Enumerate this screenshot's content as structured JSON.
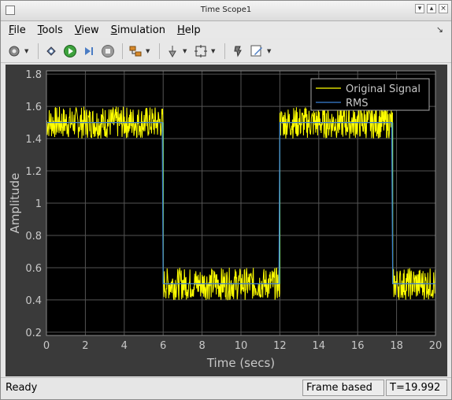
{
  "window": {
    "title": "Time Scope1"
  },
  "menu": {
    "items": [
      {
        "label": "File",
        "accel": "F",
        "rest": "ile"
      },
      {
        "label": "Tools",
        "accel": "T",
        "rest": "ools"
      },
      {
        "label": "View",
        "accel": "V",
        "rest": "iew"
      },
      {
        "label": "Simulation",
        "accel": "S",
        "rest": "imulation"
      },
      {
        "label": "Help",
        "accel": "H",
        "rest": "elp"
      }
    ]
  },
  "status": {
    "ready": "Ready",
    "mode": "Frame based",
    "time": "T=19.992"
  },
  "colors": {
    "plot_bg": "#000000",
    "figure_bg": "#3a3a3a",
    "grid": "#555555",
    "original_signal": "#ffff00",
    "rms": "#3b7fd4",
    "axis_text": "#c8c8c8"
  },
  "chart_data": {
    "type": "line",
    "xlabel": "Time (secs)",
    "ylabel": "Amplitude",
    "xlim": [
      0,
      20
    ],
    "ylim": [
      0.18,
      1.82
    ],
    "xticks": [
      "0",
      "2",
      "4",
      "6",
      "8",
      "10",
      "12",
      "14",
      "16",
      "18",
      "20"
    ],
    "yticks": [
      "0.2",
      "0.4",
      "0.6",
      "0.8",
      "1",
      "1.2",
      "1.4",
      "1.6",
      "1.8"
    ],
    "grid": true,
    "legend_position": "top-right",
    "series": [
      {
        "name": "Original Signal",
        "color": "#ffff00",
        "segments": [
          {
            "x0": 0,
            "x1": 6,
            "center": 1.5,
            "noise": 0.1
          },
          {
            "x0": 6,
            "x1": 12,
            "center": 0.5,
            "noise": 0.1
          },
          {
            "x0": 12,
            "x1": 17.8,
            "center": 1.5,
            "noise": 0.1
          },
          {
            "x0": 17.8,
            "x1": 20,
            "center": 0.5,
            "noise": 0.1
          }
        ]
      },
      {
        "name": "RMS",
        "color": "#3b7fd4",
        "x": [
          0,
          5.95,
          6.0,
          11.95,
          12.0,
          17.75,
          17.8,
          20
        ],
        "y": [
          1.5,
          1.5,
          0.5,
          0.5,
          1.5,
          1.5,
          0.5,
          0.5
        ]
      }
    ]
  },
  "toolbar": {
    "icons": [
      "gear-icon",
      "highlight-icon",
      "run-icon",
      "step-forward-icon",
      "stop-icon",
      "signal-select-icon",
      "signal-probe-icon",
      "zoom-fit-icon",
      "pin-icon",
      "style-icon"
    ]
  }
}
